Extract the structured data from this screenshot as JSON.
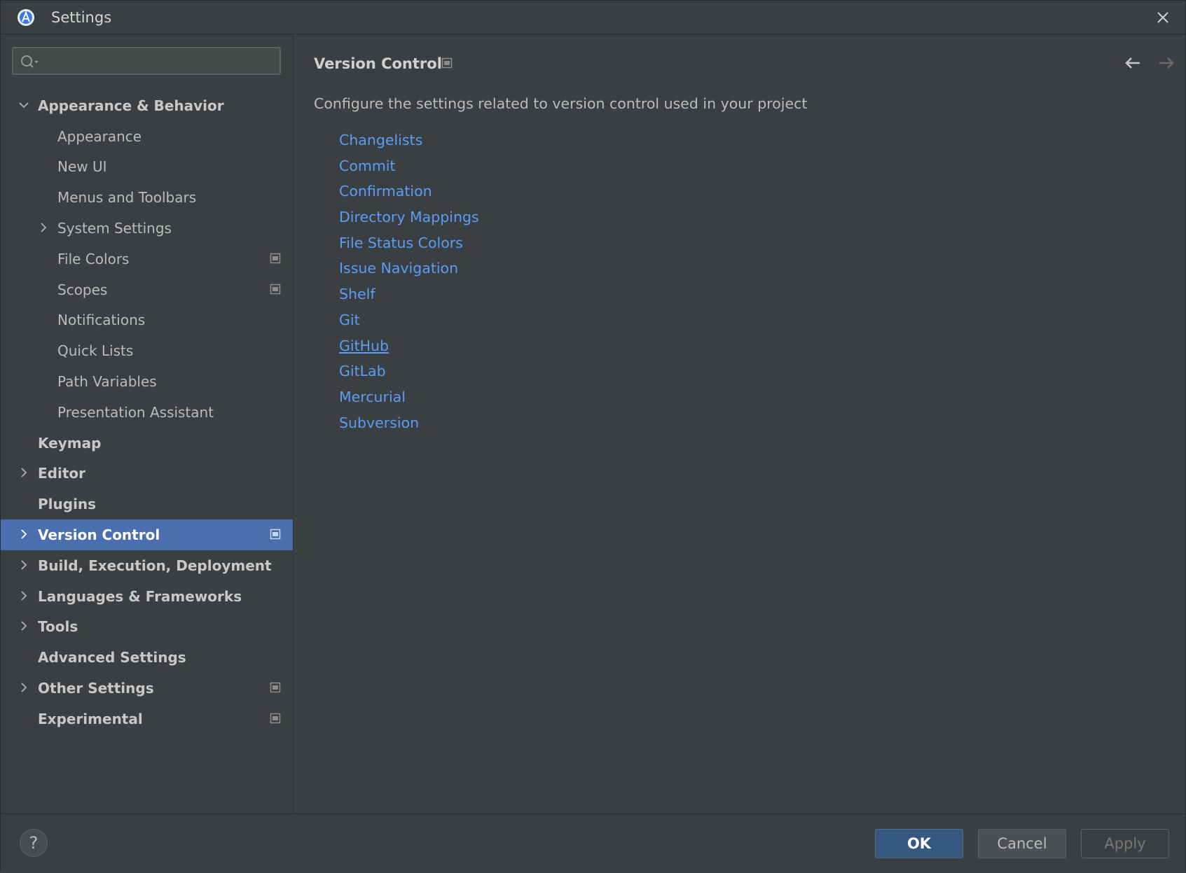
{
  "window": {
    "title": "Settings"
  },
  "search": {
    "value": "",
    "placeholder": ""
  },
  "sidebar": {
    "items": [
      {
        "label": "Appearance & Behavior",
        "level": 0,
        "chevron": "down",
        "project_icon": false,
        "selected": false
      },
      {
        "label": "Appearance",
        "level": 1,
        "chevron": "none",
        "project_icon": false,
        "selected": false
      },
      {
        "label": "New UI",
        "level": 1,
        "chevron": "none",
        "project_icon": false,
        "selected": false
      },
      {
        "label": "Menus and Toolbars",
        "level": 1,
        "chevron": "none",
        "project_icon": false,
        "selected": false
      },
      {
        "label": "System Settings",
        "level": 1,
        "chevron": "right",
        "project_icon": false,
        "selected": false
      },
      {
        "label": "File Colors",
        "level": 1,
        "chevron": "none",
        "project_icon": true,
        "selected": false
      },
      {
        "label": "Scopes",
        "level": 1,
        "chevron": "none",
        "project_icon": true,
        "selected": false
      },
      {
        "label": "Notifications",
        "level": 1,
        "chevron": "none",
        "project_icon": false,
        "selected": false
      },
      {
        "label": "Quick Lists",
        "level": 1,
        "chevron": "none",
        "project_icon": false,
        "selected": false
      },
      {
        "label": "Path Variables",
        "level": 1,
        "chevron": "none",
        "project_icon": false,
        "selected": false
      },
      {
        "label": "Presentation Assistant",
        "level": 1,
        "chevron": "none",
        "project_icon": false,
        "selected": false
      },
      {
        "label": "Keymap",
        "level": 0,
        "chevron": "none",
        "project_icon": false,
        "selected": false
      },
      {
        "label": "Editor",
        "level": 0,
        "chevron": "right",
        "project_icon": false,
        "selected": false
      },
      {
        "label": "Plugins",
        "level": 0,
        "chevron": "none",
        "project_icon": false,
        "selected": false
      },
      {
        "label": "Version Control",
        "level": 0,
        "chevron": "right",
        "project_icon": true,
        "selected": true
      },
      {
        "label": "Build, Execution, Deployment",
        "level": 0,
        "chevron": "right",
        "project_icon": false,
        "selected": false
      },
      {
        "label": "Languages & Frameworks",
        "level": 0,
        "chevron": "right",
        "project_icon": false,
        "selected": false
      },
      {
        "label": "Tools",
        "level": 0,
        "chevron": "right",
        "project_icon": false,
        "selected": false
      },
      {
        "label": "Advanced Settings",
        "level": 0,
        "chevron": "none",
        "project_icon": false,
        "selected": false
      },
      {
        "label": "Other Settings",
        "level": 0,
        "chevron": "right",
        "project_icon": true,
        "selected": false
      },
      {
        "label": "Experimental",
        "level": 0,
        "chevron": "none",
        "project_icon": true,
        "selected": false
      }
    ]
  },
  "main": {
    "title": "Version Control",
    "description": "Configure the settings related to version control used in your project",
    "links": [
      {
        "label": "Changelists",
        "hovered": false
      },
      {
        "label": "Commit",
        "hovered": false
      },
      {
        "label": "Confirmation",
        "hovered": false
      },
      {
        "label": "Directory Mappings",
        "hovered": false
      },
      {
        "label": "File Status Colors",
        "hovered": false
      },
      {
        "label": "Issue Navigation",
        "hovered": false
      },
      {
        "label": "Shelf",
        "hovered": false
      },
      {
        "label": "Git",
        "hovered": false
      },
      {
        "label": "GitHub",
        "hovered": true
      },
      {
        "label": "GitLab",
        "hovered": false
      },
      {
        "label": "Mercurial",
        "hovered": false
      },
      {
        "label": "Subversion",
        "hovered": false
      }
    ]
  },
  "footer": {
    "help_label": "?",
    "ok_label": "OK",
    "cancel_label": "Cancel",
    "apply_label": "Apply"
  },
  "colors": {
    "background": "#3c3f41",
    "selection": "#4b6eaf",
    "link": "#589df6",
    "ok_button": "#365880"
  },
  "icons": {
    "app": "android-studio-logo-icon",
    "close": "close-icon",
    "search": "search-icon",
    "project_scope": "project-scope-icon",
    "back": "arrow-left-icon",
    "forward": "arrow-right-icon",
    "help": "help-icon"
  }
}
